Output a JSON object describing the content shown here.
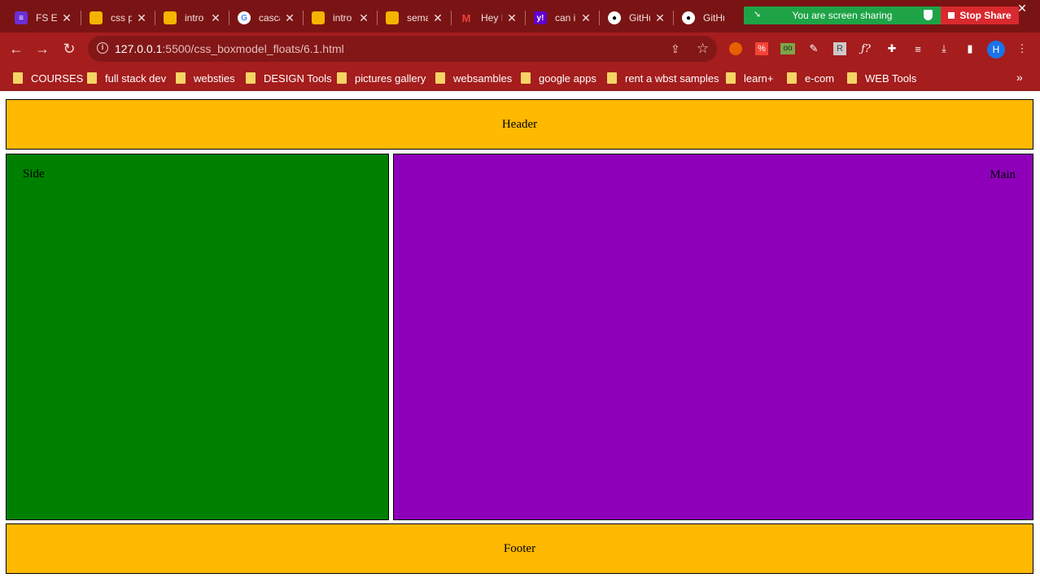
{
  "browser": {
    "tabs": [
      {
        "title": "FS EA",
        "icon": "fs-app-icon",
        "color": "#6b2fd6"
      },
      {
        "title": "css p",
        "icon": "google-slides-icon",
        "color": "#f4b400"
      },
      {
        "title": "intro",
        "icon": "google-slides-icon",
        "color": "#f4b400"
      },
      {
        "title": "casca",
        "icon": "google-icon",
        "color": "#ffffff"
      },
      {
        "title": "intro",
        "icon": "google-slides-icon",
        "color": "#f4b400"
      },
      {
        "title": "sema",
        "icon": "google-slides-icon",
        "color": "#f4b400"
      },
      {
        "title": "Hey I",
        "icon": "gmail-icon",
        "color": "#ea4335"
      },
      {
        "title": "can i",
        "icon": "yahoo-icon",
        "color": "#6001d2"
      },
      {
        "title": "GitHu",
        "icon": "github-icon",
        "color": "#ffffff"
      },
      {
        "title": "GitHu",
        "icon": "github-icon",
        "color": "#ffffff"
      }
    ],
    "screen_share": {
      "message": "You are screen sharing",
      "stop_label": "Stop Share"
    },
    "address": {
      "host": "127.0.0.1",
      "rest": ":5500/css_boxmodel_floats/6.1.html"
    },
    "profile_initial": "H",
    "bookmarks": [
      "COURSES",
      "full stack dev",
      "websties",
      "DESIGN Tools",
      "pictures gallery",
      "websambles",
      "google apps",
      "rent a wbst samples",
      "learn+",
      "e-com",
      "WEB Tools"
    ],
    "bookmarks_overflow": "»"
  },
  "page": {
    "header": "Header",
    "side": "Side",
    "main": "Main",
    "footer": "Footer",
    "colors": {
      "header": "#ffb900",
      "side": "#008000",
      "main": "#8e00b9",
      "footer": "#ffb900"
    }
  }
}
